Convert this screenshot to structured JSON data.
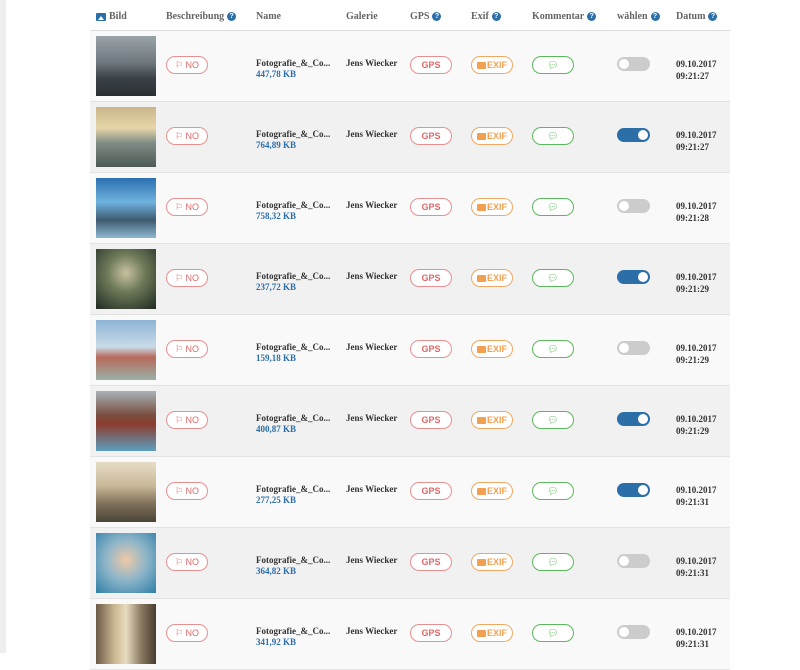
{
  "header": {
    "bild": "Bild",
    "beschreibung": "Beschreibung",
    "name": "Name",
    "galerie": "Galerie",
    "gps": "GPS",
    "exif": "Exif",
    "kommentar": "Kommentar",
    "waehlen": "wählen",
    "datum": "Datum",
    "help_glyph": "?"
  },
  "icons": {
    "bild": "image-icon",
    "help": "question-circle-icon",
    "flag": "flag-icon",
    "camera": "camera-icon",
    "comment": "comments-icon"
  },
  "colors": {
    "accent_blue": "#2c6ea8",
    "no_red": "#e06868",
    "exif_orange": "#f0a050",
    "comment_green": "#5cb85c"
  },
  "rows": [
    {
      "no": "NO",
      "name": "Fotografie_&_Co...",
      "size": "447,78 KB",
      "galerie": "Jens Wiecker",
      "gps": "GPS",
      "exif": "EXIF",
      "selected": false,
      "date": "09.10.2017",
      "time": "09:21:27"
    },
    {
      "no": "NO",
      "name": "Fotografie_&_Co...",
      "size": "764,89 KB",
      "galerie": "Jens Wiecker",
      "gps": "GPS",
      "exif": "EXIF",
      "selected": true,
      "date": "09.10.2017",
      "time": "09:21:27"
    },
    {
      "no": "NO",
      "name": "Fotografie_&_Co...",
      "size": "758,32 KB",
      "galerie": "Jens Wiecker",
      "gps": "GPS",
      "exif": "EXIF",
      "selected": false,
      "date": "09.10.2017",
      "time": "09:21:28"
    },
    {
      "no": "NO",
      "name": "Fotografie_&_Co...",
      "size": "237,72 KB",
      "galerie": "Jens Wiecker",
      "gps": "GPS",
      "exif": "EXIF",
      "selected": true,
      "date": "09.10.2017",
      "time": "09:21:29"
    },
    {
      "no": "NO",
      "name": "Fotografie_&_Co...",
      "size": "159,18 KB",
      "galerie": "Jens Wiecker",
      "gps": "GPS",
      "exif": "EXIF",
      "selected": false,
      "date": "09.10.2017",
      "time": "09:21:29"
    },
    {
      "no": "NO",
      "name": "Fotografie_&_Co...",
      "size": "400,87 KB",
      "galerie": "Jens Wiecker",
      "gps": "GPS",
      "exif": "EXIF",
      "selected": true,
      "date": "09.10.2017",
      "time": "09:21:29"
    },
    {
      "no": "NO",
      "name": "Fotografie_&_Co...",
      "size": "277,25 KB",
      "galerie": "Jens Wiecker",
      "gps": "GPS",
      "exif": "EXIF",
      "selected": true,
      "date": "09.10.2017",
      "time": "09:21:31"
    },
    {
      "no": "NO",
      "name": "Fotografie_&_Co...",
      "size": "364,82 KB",
      "galerie": "Jens Wiecker",
      "gps": "GPS",
      "exif": "EXIF",
      "selected": false,
      "date": "09.10.2017",
      "time": "09:21:31"
    },
    {
      "no": "NO",
      "name": "Fotografie_&_Co...",
      "size": "341,92 KB",
      "galerie": "Jens Wiecker",
      "gps": "GPS",
      "exif": "EXIF",
      "selected": false,
      "date": "09.10.2017",
      "time": "09:21:31"
    }
  ]
}
